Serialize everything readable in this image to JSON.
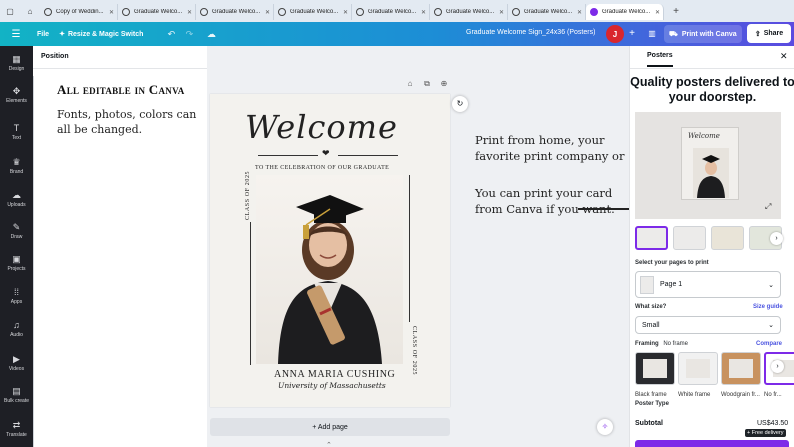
{
  "browser": {
    "tabs": [
      {
        "title": "Copy of Weddin..."
      },
      {
        "title": "Graduate Welco..."
      },
      {
        "title": "Graduate Welco..."
      },
      {
        "title": "Graduate Welco..."
      },
      {
        "title": "Graduate Welco..."
      },
      {
        "title": "Graduate Welco..."
      },
      {
        "title": "Graduate Welco..."
      },
      {
        "title": "Graduate Welco..."
      }
    ],
    "new_tab": "+"
  },
  "header": {
    "file": "File",
    "resize": "Resize & Magic Switch",
    "doc_title": "Graduate Welcome Sign_24x36 (Posters)",
    "avatar_initial": "J",
    "print": "Print with Canva",
    "share": "Share"
  },
  "rail": [
    {
      "label": "Design",
      "icon": "design-icon",
      "glyph": "▦"
    },
    {
      "label": "Elements",
      "icon": "elements-icon",
      "glyph": "✥"
    },
    {
      "label": "Text",
      "icon": "text-icon",
      "glyph": "T"
    },
    {
      "label": "Brand",
      "icon": "brand-icon",
      "glyph": "♛"
    },
    {
      "label": "Uploads",
      "icon": "uploads-icon",
      "glyph": "☁"
    },
    {
      "label": "Draw",
      "icon": "draw-icon",
      "glyph": "✎"
    },
    {
      "label": "Projects",
      "icon": "projects-icon",
      "glyph": "▣"
    },
    {
      "label": "Apps",
      "icon": "apps-icon",
      "glyph": "⁞⁞"
    },
    {
      "label": "Audio",
      "icon": "audio-icon",
      "glyph": "♫"
    },
    {
      "label": "Videos",
      "icon": "videos-icon",
      "glyph": "▶"
    },
    {
      "label": "Bulk create",
      "icon": "bulk-create-icon",
      "glyph": "▤"
    },
    {
      "label": "Translate",
      "icon": "translate-icon",
      "glyph": "⇄"
    }
  ],
  "panel": {
    "title": "Position"
  },
  "editor_text": {
    "heading": "All editable in Canva",
    "body": "Fonts, photos, colors can all be changed."
  },
  "poster": {
    "welcome": "Welcome",
    "celebration": "TO THE CELEBRATION OF OUR GRADUATE",
    "class_left": "CLASS OF 2025",
    "class_right": "CLASS OF 2025",
    "name": "ANNA MARIA CUSHING",
    "university": "University of Massachusetts"
  },
  "promo": {
    "line1": "Print from home, your favorite print company or",
    "line2": "You can print your card from Canva if you want."
  },
  "canvas": {
    "add_page": "+ Add page"
  },
  "print_panel": {
    "tab": "Posters",
    "headline": "Quality posters delivered to your doorstep.",
    "preview_title": "Welcome",
    "select_pages_label": "Select your pages to print",
    "page_select": "Page 1",
    "what_size_label": "What size?",
    "size_guide": "Size guide",
    "size_value": "Small",
    "framing_label": "Framing",
    "framing_value": "No frame",
    "compare": "Compare",
    "frames": [
      {
        "label": "Black frame",
        "color": "#2a2b2f"
      },
      {
        "label": "White frame",
        "color": "#f1f1f1"
      },
      {
        "label": "Woodgrain fr...",
        "color": "#c8925f"
      },
      {
        "label": "No fr...",
        "color": "#ffffff"
      }
    ],
    "poster_type_label": "Poster Type",
    "subtotal_label": "Subtotal",
    "price": "US$43.50",
    "free_delivery": "+ Free delivery"
  },
  "colors": {
    "accent": "#7d2ae8",
    "header_start": "#12b3c5",
    "header_end": "#5b4be0",
    "rail_bg": "#1e1f25",
    "link": "#4a53e0"
  }
}
